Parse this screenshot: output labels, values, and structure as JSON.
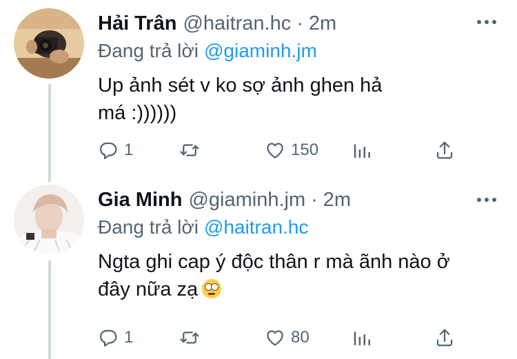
{
  "tweets": [
    {
      "author_name": "Hải Trân",
      "handle": "@haitran.hc",
      "separator": "·",
      "time": "2m",
      "replying_label": "Đang trả lời",
      "replying_to": "@giaminh.jm",
      "text": "Up ảnh sét v ko sợ ảnh ghen hả má :))))))",
      "reply_count": "1",
      "retweet_count": "",
      "like_count": "150",
      "avatar_colors": [
        "#e6c59a",
        "#8c6b45",
        "#2b2522"
      ]
    },
    {
      "author_name": "Gia Minh",
      "handle": "@giaminh.jm",
      "separator": "·",
      "time": "2m",
      "replying_label": "Đang trả lời",
      "replying_to": "@haitran.hc",
      "text": "Ngta ghi cap ý độc thân r mà ãnh nào ở đây nữa zạ",
      "emoji": "face-with-rolling-eyes",
      "reply_count": "1",
      "retweet_count": "",
      "like_count": "80",
      "avatar_colors": [
        "#f1ecea",
        "#e7ccbc",
        "#9b7060"
      ]
    }
  ],
  "colors": {
    "text": "#0f1419",
    "secondary": "#536471",
    "link": "#1d9bf0",
    "thread_line": "#cfd9de"
  },
  "icons": [
    "reply-icon",
    "retweet-icon",
    "like-icon",
    "stats-icon",
    "share-icon",
    "more-icon"
  ]
}
